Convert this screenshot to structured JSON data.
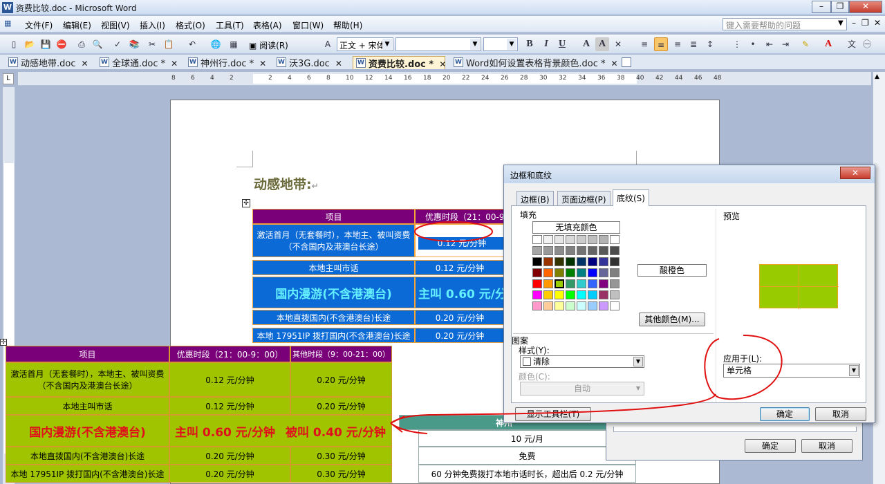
{
  "window": {
    "title": "资费比较.doc - Microsoft Word",
    "app_icon": "W"
  },
  "menu": {
    "items": [
      "文件(F)",
      "编辑(E)",
      "视图(V)",
      "插入(I)",
      "格式(O)",
      "工具(T)",
      "表格(A)",
      "窗口(W)",
      "帮助(H)"
    ],
    "help_placeholder": "键入需要帮助的问题"
  },
  "toolbar": {
    "read_label": "阅读(R)",
    "style_value": "正文 + 宋体",
    "font_value": "",
    "size_value": ""
  },
  "tabs": [
    {
      "label": "动感地带.doc"
    },
    {
      "label": "全球通.doc *"
    },
    {
      "label": "神州行.doc *"
    },
    {
      "label": "沃3G.doc"
    },
    {
      "label": "资费比较.doc *"
    },
    {
      "label": "Word如何设置表格背景颜色.doc *"
    }
  ],
  "ruler": {
    "numbers": [
      "8",
      "6",
      "4",
      "2",
      "",
      "2",
      "4",
      "6",
      "8",
      "10",
      "12",
      "14",
      "16",
      "18",
      "20",
      "22",
      "24",
      "26",
      "28",
      "30",
      "32",
      "34",
      "36",
      "38",
      "40",
      "42",
      "44",
      "46",
      "48"
    ]
  },
  "document": {
    "heading": "动感地带:",
    "upper_table": {
      "header": [
        "项目",
        "优惠时段（21：00-9"
      ],
      "rows": [
        [
          "激活首月（无套餐时），本地主、被叫资费",
          "（不含国内及港澳台长途）",
          "0.12 元/分钟"
        ],
        [
          "本地主叫市话",
          "0.12 元/分钟"
        ],
        [
          "国内漫游(不含港澳台)",
          "主叫 0.60 元/分"
        ],
        [
          "本地直拨国内(不含港澳台)长途",
          "0.20 元/分钟"
        ],
        [
          "本地 17951IP 拨打国内(不含港澳台)长途",
          "0.20 元/分钟"
        ]
      ]
    },
    "overlay_table": {
      "header": [
        "项目",
        "优惠时段（21：00-9：00）",
        "其他时段（9：00-21：00）"
      ],
      "rows": [
        [
          "激活首月（无套餐时），本地主、被叫资费",
          "（不含国内及港澳台长途）",
          "0.12 元/分钟",
          "0.20 元/分钟"
        ],
        [
          "本地主叫市话",
          "0.12 元/分钟",
          "0.20 元/分钟"
        ],
        [
          "国内漫游(不含港澳台)",
          "主叫 0.60 元/分钟",
          "被叫 0.40 元/分钟"
        ],
        [
          "本地直拨国内(不含港澳台)长途",
          "0.20 元/分钟",
          "0.30 元/分钟"
        ],
        [
          "本地 17951IP 拨打国内(不含港澳台)长途",
          "0.20 元/分钟",
          "0.30 元/分钟"
        ]
      ]
    },
    "lower_table": {
      "header": "神州",
      "rows": [
        "10 元/月",
        "免费",
        "60 分钟免费拨打本地市话时长，超出后 0.2 元/分钟"
      ]
    }
  },
  "dialog": {
    "title": "边框和底纹",
    "tabs": [
      "边框(B)",
      "页面边框(P)",
      "底纹(S)"
    ],
    "fill_label": "填充",
    "no_fill": "无填充颜色",
    "selected_color_name": "酸橙色",
    "more_colors": "其他颜色(M)...",
    "pattern_label": "图案",
    "style_label": "样式(Y):",
    "style_value": "清除",
    "color_label": "颜色(C):",
    "color_value": "自动",
    "preview_label": "预览",
    "apply_label": "应用于(L):",
    "apply_value": "单元格",
    "toolbar_button": "显示工具栏(T)",
    "ok": "确定",
    "cancel": "取消",
    "palette": [
      [
        "#ffffff",
        "#f2f2f2",
        "#e6e6e6",
        "#d9d9d9",
        "#cccccc",
        "#bfbfbf",
        "#b3b3b3",
        "#ffffff"
      ],
      [
        "#a6a6a6",
        "#999999",
        "#8c8c8c",
        "#808080",
        "#737373",
        "#666666",
        "#595959",
        "#4d4d4d"
      ],
      [
        "#000000",
        "#993300",
        "#333300",
        "#003300",
        "#003366",
        "#000080",
        "#333399",
        "#333333"
      ],
      [
        "#800000",
        "#ff6600",
        "#808000",
        "#008000",
        "#008080",
        "#0000ff",
        "#666699",
        "#808080"
      ],
      [
        "#ff0000",
        "#ff9900",
        "#99cc00",
        "#339966",
        "#33cccc",
        "#3366ff",
        "#800080",
        "#969696"
      ],
      [
        "#ff00ff",
        "#ffcc00",
        "#ffff00",
        "#00ff00",
        "#00ffff",
        "#00ccff",
        "#993366",
        "#c0c0c0"
      ],
      [
        "#ff99cc",
        "#ffcc99",
        "#ffff99",
        "#ccffcc",
        "#ccffff",
        "#99ccff",
        "#cc99ff",
        "#ffffff"
      ]
    ],
    "selected_swatch": "#99cc00",
    "preview_color": "#99cc00"
  },
  "dialog2": {
    "ok": "确定",
    "cancel": "取消"
  }
}
